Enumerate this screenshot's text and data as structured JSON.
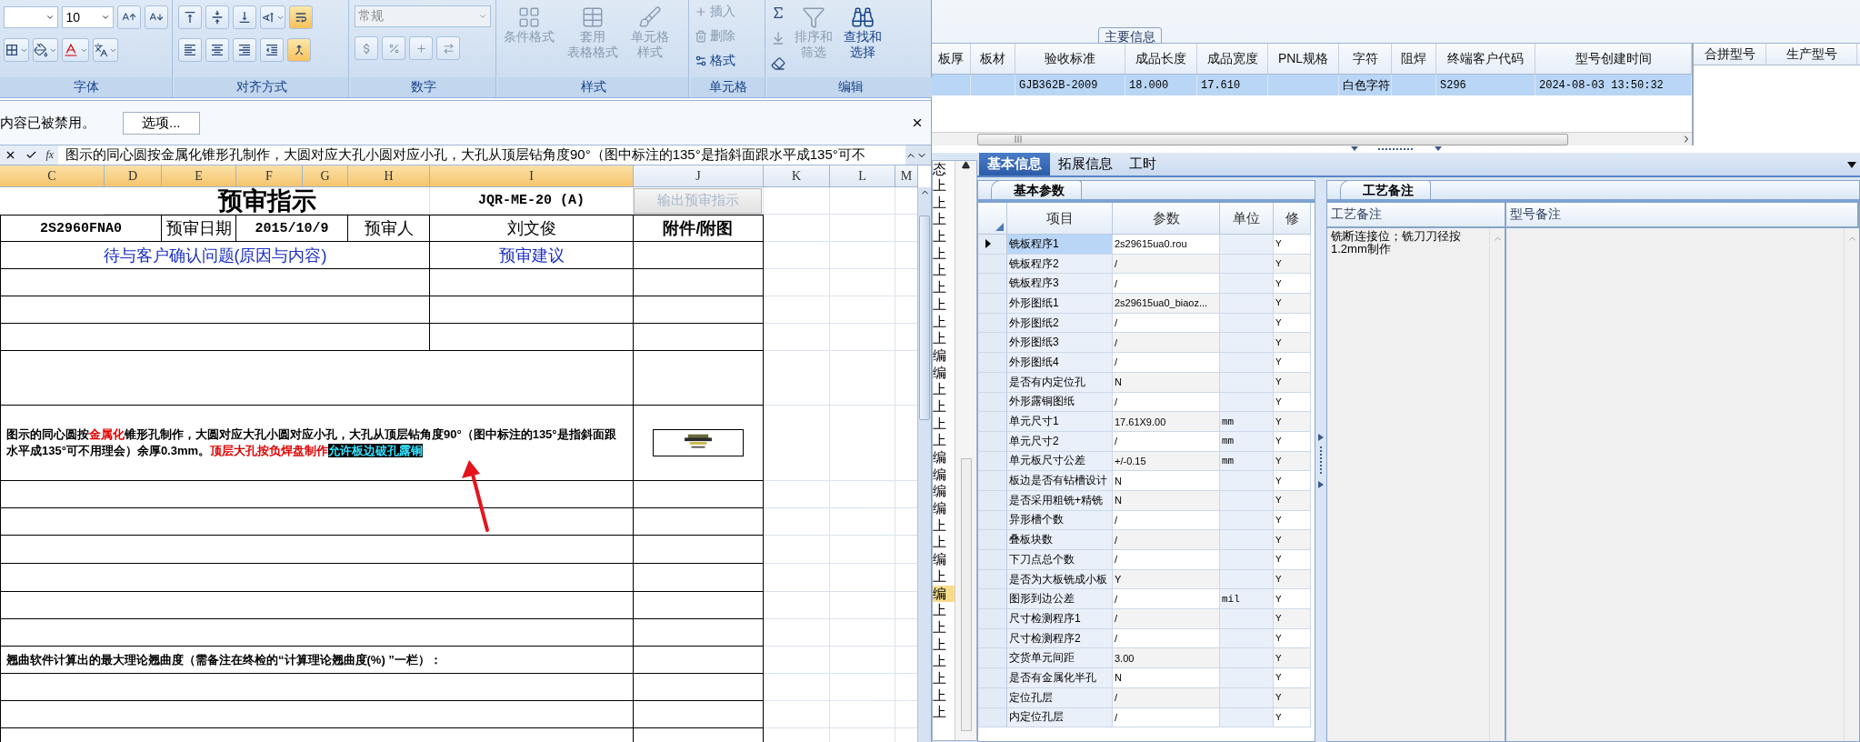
{
  "excel": {
    "ribbon": {
      "font_size": "10",
      "number_format": "常规",
      "wrap_text": true,
      "merge_center": true,
      "style_buttons": [
        {
          "lines": [
            "条件格式"
          ],
          "disabled": true
        },
        {
          "lines": [
            "套用",
            "表格格式"
          ],
          "disabled": true
        },
        {
          "lines": [
            "单元格",
            "样式"
          ],
          "disabled": true
        }
      ],
      "cell_buttons": [
        {
          "label": "插入",
          "disabled": true
        },
        {
          "label": "删除",
          "disabled": true
        },
        {
          "label": "格式",
          "disabled": false
        }
      ],
      "edit_buttons": [
        {
          "lines": [
            "排序和",
            "筛选"
          ],
          "disabled": true
        },
        {
          "lines": [
            "查找和",
            "选择"
          ],
          "disabled": false
        }
      ],
      "groups": [
        "字体",
        "对齐方式",
        "数字",
        "样式",
        "单元格",
        "编辑"
      ]
    },
    "message_bar": {
      "text": "内容已被禁用。",
      "button": "选项..."
    },
    "formula_bar": {
      "function_label": "fx",
      "text": "图示的同心圆按金属化锥形孔制作，大圆对应大孔小圆对应小孔，大孔从顶层钻角度90°（图中标注的135°是指斜面跟水平成135°可不"
    },
    "column_headers": [
      {
        "label": "C",
        "selected": true
      },
      {
        "label": "D",
        "selected": true
      },
      {
        "label": "E",
        "selected": true
      },
      {
        "label": "F",
        "selected": true
      },
      {
        "label": "G",
        "selected": true
      },
      {
        "label": "H",
        "selected": true
      },
      {
        "label": "I",
        "selected": true
      },
      {
        "label": "J",
        "selected": false
      },
      {
        "label": "K",
        "selected": false
      },
      {
        "label": "L",
        "selected": false
      },
      {
        "label": "M",
        "selected": false
      }
    ],
    "sheet": {
      "title": "预审指示",
      "form_code": "JQR-ME-20 (A)",
      "export_button": "输出预审指示",
      "info_row": [
        "2S2960FNA0",
        "预审日期",
        "2015/10/9",
        "预审人",
        "刘文俊",
        "附件/附图"
      ],
      "section_headers": [
        "待与客户确认问题(原因与内容)",
        "预审建议"
      ],
      "problem_text": [
        {
          "kind": "normal",
          "text": "图示的同心圆按"
        },
        {
          "kind": "red",
          "text": "金属化"
        },
        {
          "kind": "normal",
          "text": "锥形孔制作，大圆对应大孔小圆对应小孔，大孔从顶层钻角度90°（图中标注的135°是指斜面跟水平成135°可不用理会）余厚0.3mm。"
        },
        {
          "kind": "red",
          "text": "顶层大孔按负焊盘制作"
        },
        {
          "kind": "highlight",
          "text": "允许板边破孔露铜"
        }
      ],
      "warpage_text": "翘曲软件计算出的最大理论翘曲度（需备注在终检的“计算理论翘曲度(%) ”一栏）："
    }
  },
  "app": {
    "group_tab": "主要信息",
    "main_grid": {
      "columns": [
        "板厚",
        "板材",
        "验收标准",
        "成品长度",
        "成品宽度",
        "PNL规格",
        "字符",
        "阻焊",
        "终端客户代码",
        "型号创建时间"
      ],
      "rows": [
        {
          "selected": true,
          "cells": [
            "",
            "",
            "GJB362B-2009",
            "18.000",
            "17.610",
            "",
            "白色字符",
            "",
            "S296",
            "2024-08-03 13:50:32"
          ]
        }
      ]
    },
    "side_grid": {
      "columns": [
        "合拼型号",
        "生产型号"
      ]
    },
    "tabs": [
      {
        "label": "基本信息",
        "selected": true
      },
      {
        "label": "拓展信息",
        "selected": false
      },
      {
        "label": "工时",
        "selected": false
      }
    ],
    "status_list": {
      "header": "态",
      "items": [
        {
          "text": "上",
          "selected": false
        },
        {
          "text": "上",
          "selected": false
        },
        {
          "text": "上",
          "selected": false
        },
        {
          "text": "上",
          "selected": false
        },
        {
          "text": "上",
          "selected": false
        },
        {
          "text": "上",
          "selected": false
        },
        {
          "text": "上",
          "selected": false
        },
        {
          "text": "上",
          "selected": false
        },
        {
          "text": "上",
          "selected": false
        },
        {
          "text": "上",
          "selected": false
        },
        {
          "text": "编",
          "selected": false
        },
        {
          "text": "编",
          "selected": false
        },
        {
          "text": "上",
          "selected": false
        },
        {
          "text": "上",
          "selected": false
        },
        {
          "text": "上",
          "selected": false
        },
        {
          "text": "上",
          "selected": false
        },
        {
          "text": "编",
          "selected": false
        },
        {
          "text": "编",
          "selected": false
        },
        {
          "text": "编",
          "selected": false
        },
        {
          "text": "编",
          "selected": false
        },
        {
          "text": "上",
          "selected": false
        },
        {
          "text": "上",
          "selected": false
        },
        {
          "text": "编",
          "selected": false
        },
        {
          "text": "上",
          "selected": false
        },
        {
          "text": "编",
          "selected": true
        },
        {
          "text": "上",
          "selected": false
        },
        {
          "text": "上",
          "selected": false
        },
        {
          "text": "上",
          "selected": false
        },
        {
          "text": "上",
          "selected": false
        },
        {
          "text": "上",
          "selected": false
        },
        {
          "text": "上",
          "selected": false
        },
        {
          "text": "上",
          "selected": false
        }
      ]
    },
    "params_panel": {
      "tab": "基本参数",
      "columns": [
        "项目",
        "参数",
        "单位",
        "修"
      ],
      "rows": [
        {
          "item": "铣板程序1",
          "param": "2s29615ua0.rou",
          "modified": "Y",
          "selected": true
        },
        {
          "item": "铣板程序2",
          "param": "/",
          "modified": "Y",
          "selected": false
        },
        {
          "item": "铣板程序3",
          "param": "/",
          "modified": "Y",
          "selected": false
        },
        {
          "item": "外形图纸1",
          "param": "2s29615ua0_biaoz...",
          "modified": "Y",
          "selected": false
        },
        {
          "item": "外形图纸2",
          "param": "/",
          "modified": "Y",
          "selected": false
        },
        {
          "item": "外形图纸3",
          "param": "/",
          "modified": "Y",
          "selected": false
        },
        {
          "item": "外形图纸4",
          "param": "/",
          "modified": "Y",
          "selected": false
        },
        {
          "item": "是否有内定位孔",
          "param": "N",
          "modified": "Y",
          "selected": false
        },
        {
          "item": "外形露铜图纸",
          "param": "/",
          "modified": "Y",
          "selected": false
        },
        {
          "item": "单元尺寸1",
          "param": "17.61X9.00",
          "unit": "mm",
          "modified": "Y",
          "selected": false
        },
        {
          "item": "单元尺寸2",
          "param": "/",
          "unit": "mm",
          "modified": "Y",
          "selected": false
        },
        {
          "item": "单元板尺寸公差",
          "param": "+/-0.15",
          "unit": "mm",
          "modified": "Y",
          "selected": false
        },
        {
          "item": "板边是否有钻槽设计",
          "param": "N",
          "modified": "Y",
          "selected": false
        },
        {
          "item": "是否采用粗铣+精铣",
          "param": "N",
          "modified": "Y",
          "selected": false
        },
        {
          "item": "异形槽个数",
          "param": "/",
          "modified": "Y",
          "selected": false
        },
        {
          "item": "叠板块数",
          "param": "/",
          "modified": "Y",
          "selected": false
        },
        {
          "item": "下刀点总个数",
          "param": "/",
          "modified": "Y",
          "selected": false
        },
        {
          "item": "是否为大板铣成小板",
          "param": "Y",
          "modified": "Y",
          "selected": false
        },
        {
          "item": "图形到边公差",
          "param": "/",
          "unit": "mil",
          "modified": "Y",
          "selected": false
        },
        {
          "item": "尺寸检测程序1",
          "param": "/",
          "modified": "Y",
          "selected": false
        },
        {
          "item": "尺寸检测程序2",
          "param": "/",
          "modified": "Y",
          "selected": false
        },
        {
          "item": "交货单元间距",
          "param": "3.00",
          "modified": "Y",
          "selected": false
        },
        {
          "item": "是否有金属化半孔",
          "param": "N",
          "modified": "Y",
          "selected": false
        },
        {
          "item": "定位孔层",
          "param": "/",
          "modified": "Y",
          "selected": false
        },
        {
          "item": "内定位孔层",
          "param": "/",
          "modified": "Y",
          "selected": false
        }
      ]
    },
    "notes_panel": {
      "tab": "工艺备注",
      "columns": [
        "工艺备注",
        "型号备注"
      ],
      "process_note": "铣断连接位；铣刀刀径按1.2mm制作"
    }
  }
}
